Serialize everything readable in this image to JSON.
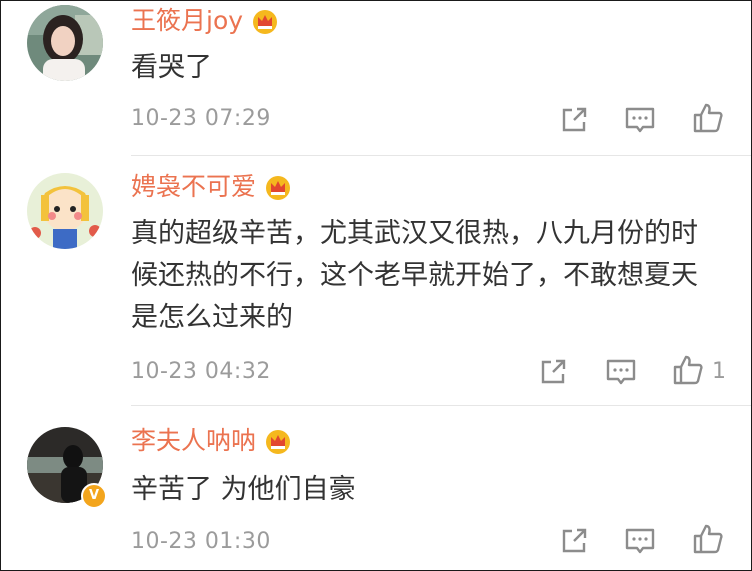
{
  "comments": [
    {
      "username": "王筱月joy",
      "text": "看哭了",
      "timestamp": "10-23 07:29",
      "likes": "",
      "verified": false,
      "badge_icon": "crown-vip-icon"
    },
    {
      "username": "娉袅不可爱",
      "text": "真的超级辛苦，尤其武汉又很热，八九月份的时候还热的不行，这个老早就开始了，不敢想夏天是怎么过来的",
      "timestamp": "10-23 04:32",
      "likes": "1",
      "verified": false,
      "badge_icon": "crown-vip-icon"
    },
    {
      "username": "李夫人呐呐",
      "text": "辛苦了 为他们自豪",
      "timestamp": "10-23 01:30",
      "likes": "",
      "verified": true,
      "verified_mark": "V",
      "badge_icon": "crown-vip-icon"
    }
  ],
  "colors": {
    "username": "#eb7350",
    "text": "#333333",
    "meta": "#9b9b9b",
    "divider": "#e6e6e6",
    "crown": "#f5b81e",
    "verified": "#f3a51d"
  },
  "icons": [
    "share-icon",
    "comment-icon",
    "like-icon"
  ]
}
